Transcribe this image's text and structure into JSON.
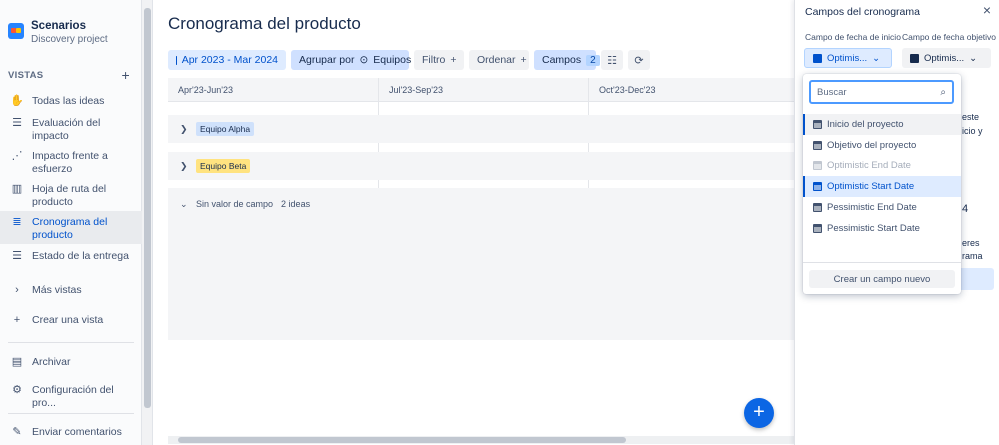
{
  "project": {
    "name": "Scenarios",
    "subtitle": "Discovery project"
  },
  "sidebar": {
    "views_header": "VISTAS",
    "add_icon": "+",
    "items": [
      {
        "label": "Todas las ideas",
        "icon": "hand-wave-icon"
      },
      {
        "label": "Evaluación del impacto",
        "icon": "list-icon"
      },
      {
        "label": "Impacto frente a esfuerzo",
        "icon": "scatter-chart-icon"
      },
      {
        "label": "Hoja de ruta del producto",
        "icon": "board-icon"
      },
      {
        "label": "Cronograma del producto",
        "icon": "timeline-icon",
        "active": true
      },
      {
        "label": "Estado de la entrega",
        "icon": "list-icon"
      },
      {
        "label": "Más vistas",
        "icon": "chevron-right-icon"
      },
      {
        "label": "Crear una vista",
        "icon": "plus-icon"
      }
    ],
    "archive": "Archivar",
    "settings": "Configuración del pro...",
    "feedback": "Enviar comentarios"
  },
  "main": {
    "title": "Cronograma del producto",
    "toolbar": {
      "date_range": "Apr 2023 - Mar 2024",
      "group_by": "Agrupar por",
      "group_value": "Equipos",
      "filter": "Filtro",
      "sort": "Ordenar",
      "fields": "Campos",
      "fields_count": "2"
    },
    "timeline": {
      "columns": [
        "Apr'23-Jun'23",
        "Jul'23-Sep'23",
        "Oct'23-Dec'23"
      ],
      "groups": [
        {
          "label": "Equipo Alpha"
        },
        {
          "label": "Equipo Beta"
        }
      ],
      "empty_group": {
        "label": "Sin valor de campo",
        "count": "2 ideas"
      }
    }
  },
  "panel": {
    "title": "Campos del cronograma",
    "start_label": "Campo de fecha de inicio",
    "target_label": "Campo de fecha objetivo",
    "start_value": "Optimis...",
    "target_value": "Optimis...",
    "bg_fragments": [
      "este",
      "icio y",
      "4",
      "eres",
      "rama"
    ]
  },
  "dropdown": {
    "search_placeholder": "Buscar",
    "options": [
      {
        "label": "Inicio del proyecto",
        "state": "hover"
      },
      {
        "label": "Objetivo del proyecto",
        "state": "normal"
      },
      {
        "label": "Optimistic End Date",
        "state": "disabled"
      },
      {
        "label": "Optimistic Start Date",
        "state": "selected"
      },
      {
        "label": "Pessimistic End Date",
        "state": "normal"
      },
      {
        "label": "Pessimistic Start Date",
        "state": "normal"
      }
    ],
    "create_label": "Crear un campo nuevo"
  },
  "colors": {
    "accent": "#0052cc",
    "fab": "#0c66e4",
    "alpha_tag": "#cfe1fb",
    "beta_tag": "#ffe380"
  }
}
